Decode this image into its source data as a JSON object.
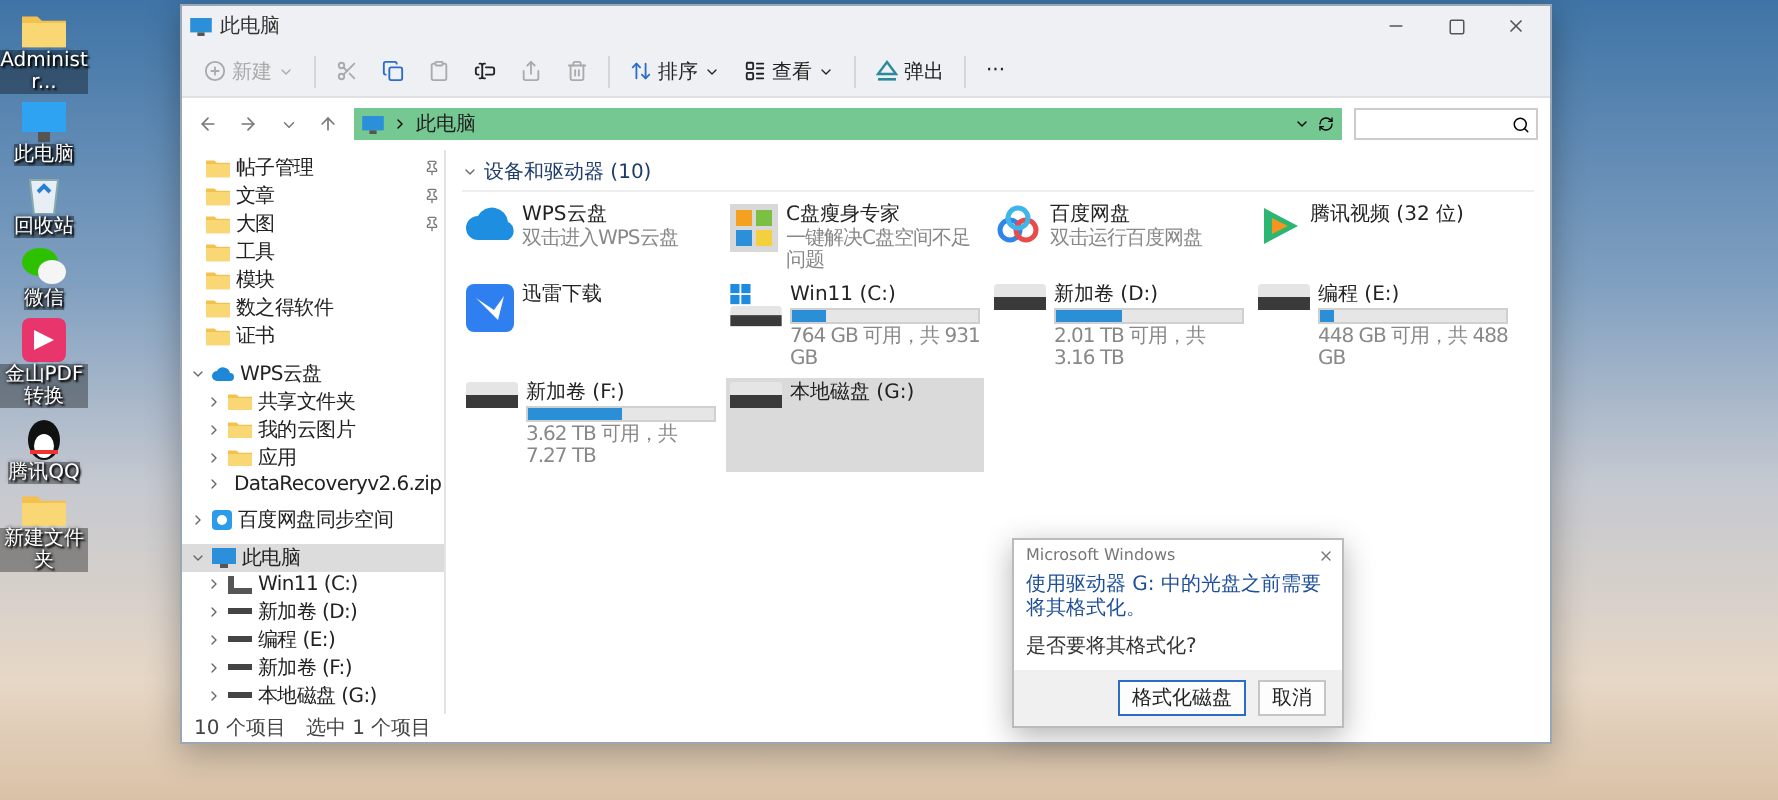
{
  "desktop": {
    "icons": [
      {
        "kind": "folder",
        "label": "Administr..."
      },
      {
        "kind": "computer",
        "label": "此电脑"
      },
      {
        "kind": "recycle",
        "label": "回收站"
      },
      {
        "kind": "chat",
        "label": "微信"
      },
      {
        "kind": "app",
        "label": "金山PDF转换"
      },
      {
        "kind": "penguin",
        "label": "腾讯QQ"
      },
      {
        "kind": "folder",
        "label": "新建文件夹"
      }
    ]
  },
  "window": {
    "title": "此电脑",
    "toolbar": [
      {
        "kind": "new",
        "label": "新建",
        "disabled": true
      },
      {
        "kind": "cut",
        "disabled": true
      },
      {
        "kind": "copy",
        "disabled": false
      },
      {
        "kind": "paste",
        "disabled": true
      },
      {
        "kind": "rename",
        "disabled": false
      },
      {
        "kind": "share",
        "disabled": true
      },
      {
        "kind": "delete",
        "disabled": true
      },
      {
        "kind": "sort",
        "label": "排序",
        "disabled": false
      },
      {
        "kind": "view",
        "label": "查看",
        "disabled": false
      },
      {
        "kind": "eject",
        "label": "弹出",
        "disabled": false
      },
      {
        "kind": "more",
        "label": "···",
        "disabled": false
      }
    ],
    "address": {
      "location": "此电脑"
    },
    "sidebar": {
      "quick_access": [
        {
          "label": "帖子管理",
          "pinned": true
        },
        {
          "label": "文章",
          "pinned": true
        },
        {
          "label": "大图",
          "pinned": true
        },
        {
          "label": "工具",
          "pinned": false
        },
        {
          "label": "模块",
          "pinned": false
        },
        {
          "label": "数之得软件",
          "pinned": false
        },
        {
          "label": "证书",
          "pinned": false
        }
      ],
      "tree": [
        {
          "kind": "cloud",
          "label": "WPS云盘",
          "expanded": true,
          "selected": false,
          "children": [
            {
              "kind": "shared-folder",
              "label": "共享文件夹",
              "expanded": false,
              "selected": false
            },
            {
              "kind": "folder",
              "label": "我的云图片",
              "expanded": false,
              "selected": false
            },
            {
              "kind": "folder",
              "label": "应用",
              "expanded": false,
              "selected": false
            },
            {
              "kind": "archive",
              "label": "DataRecoveryv2.6.zip",
              "expanded": false,
              "selected": false
            }
          ]
        },
        {
          "kind": "sync",
          "label": "百度网盘同步空间",
          "expanded": false,
          "selected": false
        },
        {
          "kind": "computer",
          "label": "此电脑",
          "expanded": true,
          "selected": true,
          "children": [
            {
              "kind": "system-drive",
              "label": "Win11 (C:)",
              "expanded": false,
              "selected": false
            },
            {
              "kind": "drive",
              "label": "新加卷 (D:)",
              "expanded": false,
              "selected": false
            },
            {
              "kind": "drive",
              "label": "编程 (E:)",
              "expanded": false,
              "selected": false
            },
            {
              "kind": "drive",
              "label": "新加卷 (F:)",
              "expanded": false,
              "selected": false
            },
            {
              "kind": "drive",
              "label": "本地磁盘 (G:)",
              "expanded": false,
              "selected": false
            }
          ]
        }
      ]
    },
    "content": {
      "group": "设备和驱动器 (10)",
      "items": [
        {
          "kind": "cloud-app",
          "name": "WPS云盘",
          "subtitle": "双击进入WPS云盘",
          "selected": false
        },
        {
          "kind": "cleaner-app",
          "name": "C盘瘦身专家",
          "subtitle": "一键解决C盘空间不足问题",
          "selected": false
        },
        {
          "kind": "netdisk-app",
          "name": "百度网盘",
          "subtitle": "双击运行百度网盘",
          "selected": false
        },
        {
          "kind": "video-app",
          "name": "腾讯视频 (32 位)",
          "selected": false
        },
        {
          "kind": "download-app",
          "name": "迅雷下载",
          "selected": false
        },
        {
          "kind": "system-drive",
          "name": "Win11 (C:)",
          "level": 0.18,
          "free": "764 GB 可用，共 931 GB",
          "selected": false
        },
        {
          "kind": "drive",
          "name": "新加卷 (D:)",
          "level": 0.36,
          "free": "2.01 TB 可用，共 3.16 TB",
          "selected": false
        },
        {
          "kind": "drive",
          "name": "编程 (E:)",
          "level": 0.08,
          "free": "448 GB 可用，共 488 GB",
          "selected": false
        },
        {
          "kind": "drive",
          "name": "新加卷 (F:)",
          "level": 0.5,
          "free": "3.62 TB 可用，共 7.27 TB",
          "selected": false
        },
        {
          "kind": "optical-drive",
          "name": "本地磁盘 (G:)",
          "selected": true
        }
      ]
    },
    "status_bar": [
      "10 个项目",
      "选中 1 个项目"
    ]
  },
  "dialog": {
    "title": "Microsoft Windows",
    "heading": "使用驱动器 G: 中的光盘之前需要将其格式化。",
    "message": "是否要将其格式化?",
    "buttons": [
      {
        "label": "格式化磁盘",
        "default": true
      },
      {
        "label": "取消",
        "default": false
      }
    ]
  }
}
